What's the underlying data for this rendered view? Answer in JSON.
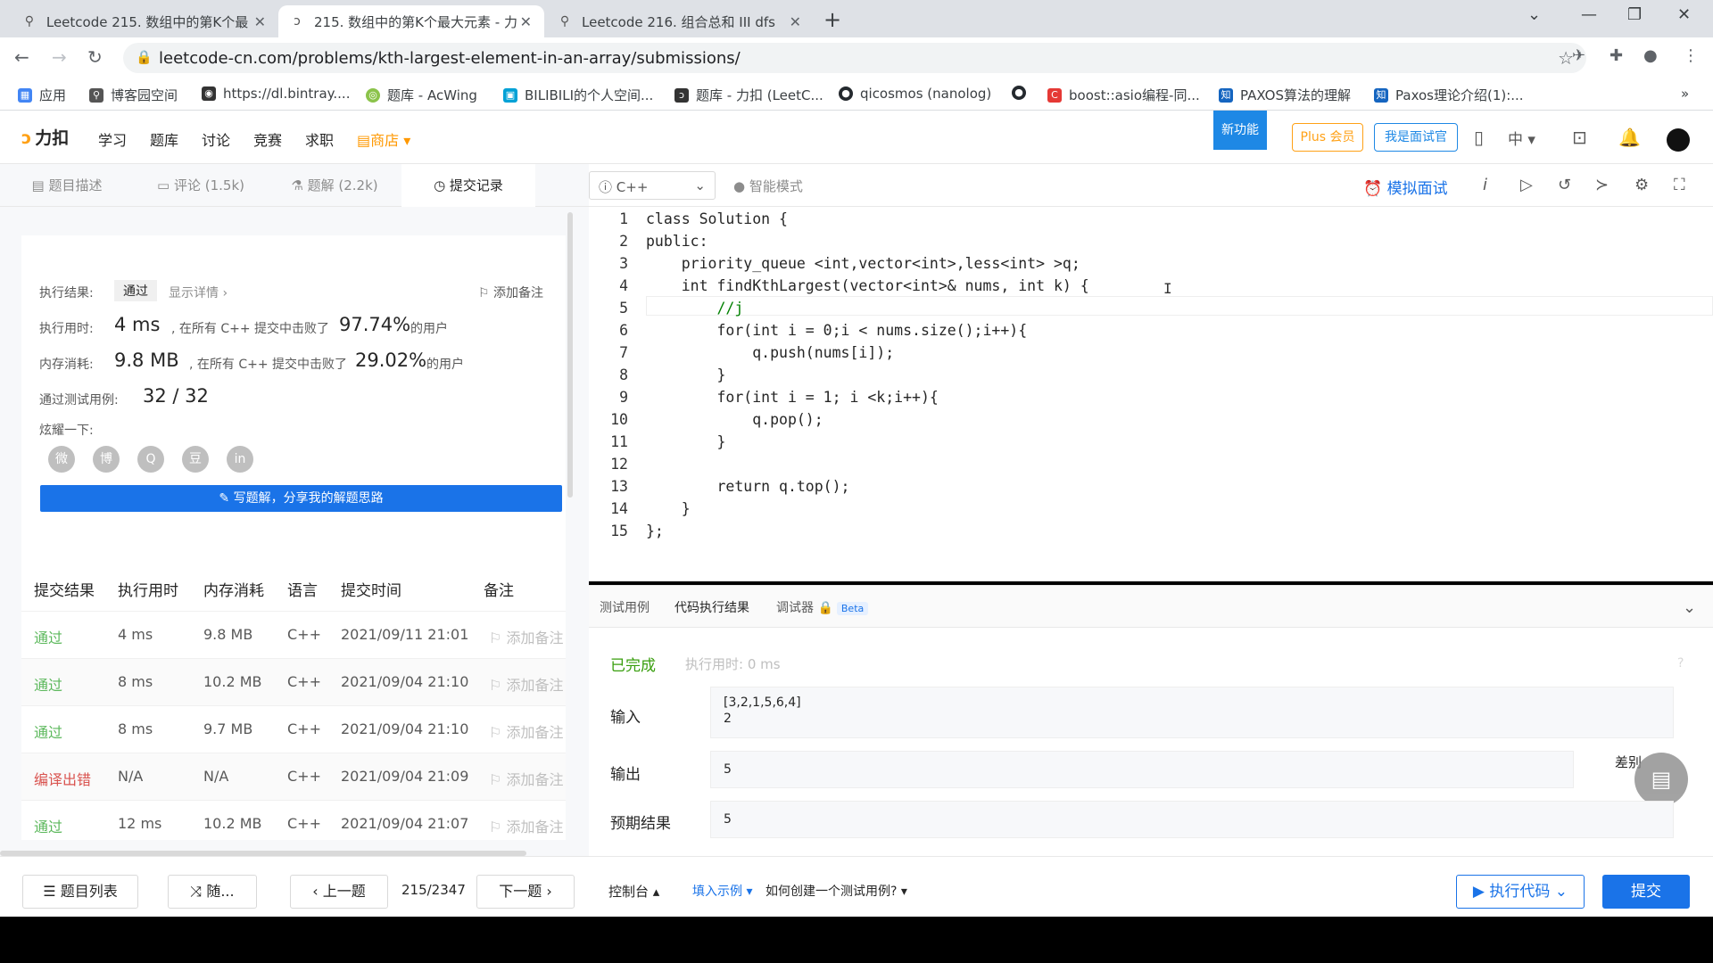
{
  "browser": {
    "tabs": [
      {
        "title": "Leetcode 215. 数组中的第K个最"
      },
      {
        "title": "215. 数组中的第K个最大元素 - 力"
      },
      {
        "title": "Leetcode 216. 组合总和 III dfs"
      }
    ],
    "url": "leetcode-cn.com/problems/kth-largest-element-in-an-array/submissions/",
    "bookmarks": [
      {
        "label": "应用",
        "color": "#4285f4"
      },
      {
        "label": "博客园空间",
        "color": "#555555"
      },
      {
        "label": "https://dl.bintray....",
        "color": "#333333"
      },
      {
        "label": "题库 - AcWing",
        "color": "#8bc34a"
      },
      {
        "label": "BILIBILI的个人空间...",
        "color": "#00a1d6"
      },
      {
        "label": "题库 - 力扣 (LeetC...",
        "color": "#333333"
      },
      {
        "label": "qicosmos (nanolog)",
        "color": "#24292e"
      },
      {
        "label": "",
        "color": "#24292e"
      },
      {
        "label": "boost::asio编程-同...",
        "color": "#e53935"
      },
      {
        "label": "PAXOS算法的理解",
        "color": "#1565c0"
      },
      {
        "label": "Paxos理论介绍(1):...",
        "color": "#1565c0"
      }
    ]
  },
  "header": {
    "logo": "力扣",
    "nav": [
      "学习",
      "题库",
      "讨论",
      "竞赛",
      "求职",
      "商店"
    ],
    "new_feature": "新功能",
    "plus": "Plus 会员",
    "interviewer": "我是面试官",
    "lang": "中"
  },
  "left_tabs": [
    "题目描述",
    "评论 (1.5k)",
    "题解 (2.2k)",
    "提交记录"
  ],
  "result": {
    "label_result": "执行结果:",
    "status": "通过",
    "show_detail": "显示详情 ›",
    "add_note": "添加备注",
    "label_time": "执行用时:",
    "time": "4 ms",
    "beat_text": ", 在所有 C++ 提交中击败了",
    "time_pct": "97.74%",
    "users": "的用户",
    "label_mem": "内存消耗:",
    "mem": "9.8 MB",
    "mem_pct": "29.02%",
    "label_cases": "通过测试用例:",
    "cases": "32 / 32",
    "share_label": "炫耀一下:",
    "share_icons": [
      "微",
      "博",
      "Q",
      "豆",
      "in"
    ],
    "write_btn": "✎ 写题解，分享我的解题思路"
  },
  "table": {
    "headers": [
      "提交结果",
      "执行用时",
      "内存消耗",
      "语言",
      "提交时间",
      "备注"
    ],
    "rows": [
      {
        "status": "通过",
        "ok": true,
        "time": "4 ms",
        "mem": "9.8 MB",
        "lang": "C++",
        "date": "2021/09/11 21:01",
        "note": "添加备注"
      },
      {
        "status": "通过",
        "ok": true,
        "time": "8 ms",
        "mem": "10.2 MB",
        "lang": "C++",
        "date": "2021/09/04 21:10",
        "note": "添加备注"
      },
      {
        "status": "通过",
        "ok": true,
        "time": "8 ms",
        "mem": "9.7 MB",
        "lang": "C++",
        "date": "2021/09/04 21:10",
        "note": "添加备注"
      },
      {
        "status": "编译出错",
        "ok": false,
        "time": "N/A",
        "mem": "N/A",
        "lang": "C++",
        "date": "2021/09/04 21:09",
        "note": "添加备注"
      },
      {
        "status": "通过",
        "ok": true,
        "time": "12 ms",
        "mem": "10.2 MB",
        "lang": "C++",
        "date": "2021/09/04 21:07",
        "note": "添加备注"
      }
    ]
  },
  "editor": {
    "language": "C++",
    "smart_mode": "智能模式",
    "mock_interview": "模拟面试",
    "lines": [
      "class Solution {",
      "public:",
      "    priority_queue <int,vector<int>,less<int> >q;",
      "    int findKthLargest(vector<int>& nums, int k) {",
      "        //j",
      "        for(int i = 0;i < nums.size();i++){",
      "            q.push(nums[i]);",
      "        }",
      "        for(int i = 1; i <k;i++){",
      "            q.pop();",
      "        }",
      "",
      "        return q.top();",
      "    }",
      "};"
    ]
  },
  "console": {
    "tabs": [
      "测试用例",
      "代码执行结果",
      "调试器"
    ],
    "beta": "Beta",
    "status": "已完成",
    "exec_time": "执行用时: 0 ms",
    "input_label": "输入",
    "input_value": "[3,2,1,5,6,4]\n2",
    "output_label": "输出",
    "output_value": "5",
    "expected_label": "预期结果",
    "expected_value": "5",
    "diff": "差别"
  },
  "footer": {
    "problem_list": "题目列表",
    "random": "随...",
    "prev": "上一题",
    "page": "215/2347",
    "next": "下一题",
    "console": "控制台",
    "fill_example": "填入示例",
    "how_create": "如何创建一个测试用例?",
    "run": "执行代码",
    "submit": "提交"
  }
}
